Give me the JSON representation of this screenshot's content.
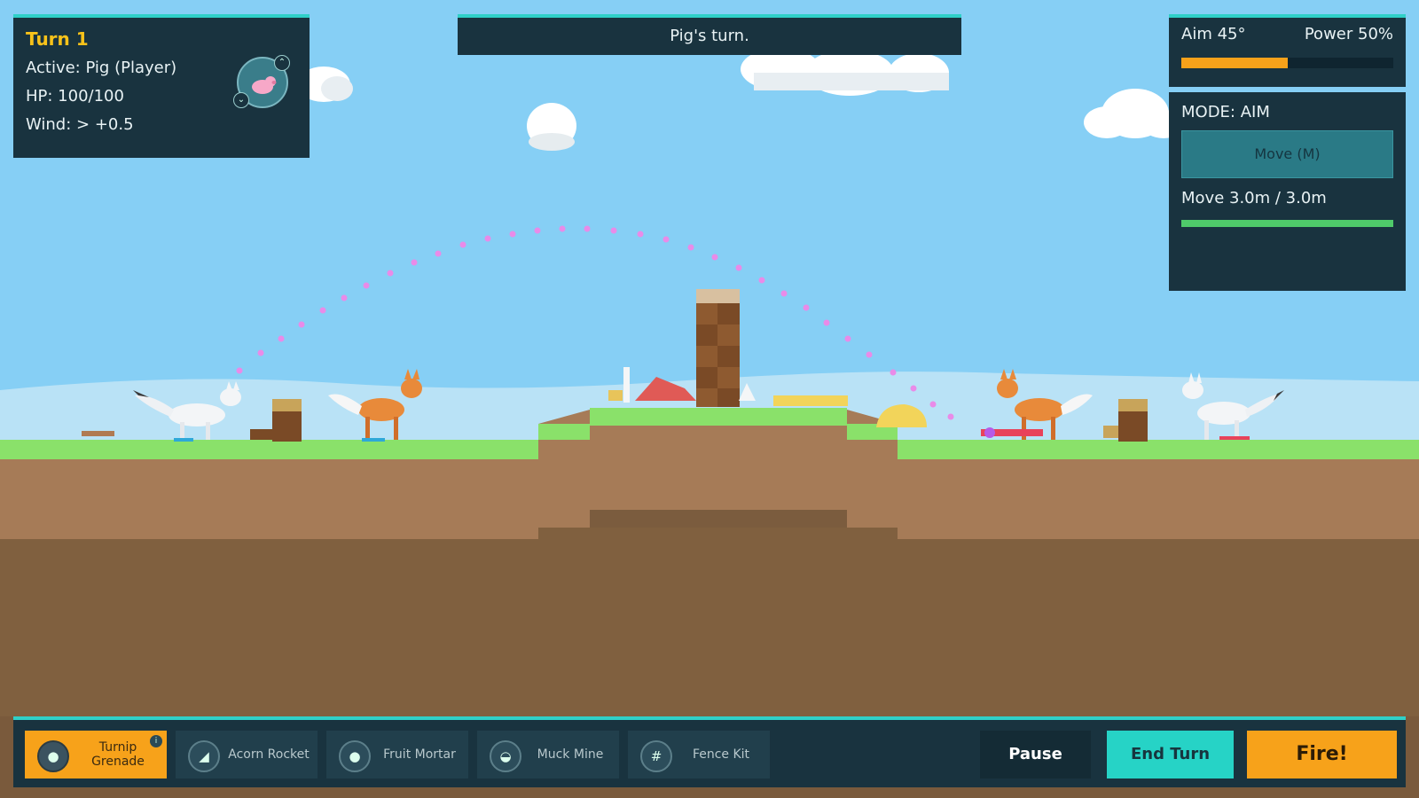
{
  "hud": {
    "turn_label": "Turn 1",
    "active": "Active: Pig (Player)",
    "hp": "HP: 100/100",
    "wind": "Wind: > +0.5",
    "avatar_icon": "pig-avatar"
  },
  "status": {
    "message": "Pig's turn."
  },
  "aim": {
    "angle_label": "Aim 45°",
    "power_label": "Power 50%",
    "power_fraction": 0.5
  },
  "mode": {
    "label": "MODE: AIM",
    "move_button": "Move (M)",
    "move_info": "Move 3.0m / 3.0m",
    "move_fraction": 1.0
  },
  "weapons": [
    {
      "name": "Turnip Grenade",
      "icon": "turnip-icon",
      "selected": true
    },
    {
      "name": "Acorn Rocket",
      "icon": "acorn-icon",
      "selected": false
    },
    {
      "name": "Fruit Mortar",
      "icon": "fruit-icon",
      "selected": false
    },
    {
      "name": "Muck Mine",
      "icon": "mine-icon",
      "selected": false
    },
    {
      "name": "Fence Kit",
      "icon": "fence-icon",
      "selected": false
    }
  ],
  "buttons": {
    "pause": "Pause",
    "end_turn": "End Turn",
    "fire": "Fire!"
  },
  "colors": {
    "accent": "#2fd0c8",
    "panel": "#19333f",
    "orange": "#f7a21a",
    "grass": "#8ae16a",
    "dirt": "#a67b57"
  }
}
